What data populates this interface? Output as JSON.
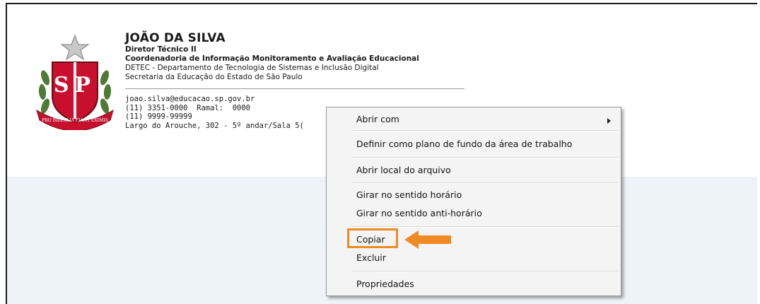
{
  "signature": {
    "name": "JOÃO DA SILVA",
    "role": "Diretor Técnico II",
    "department": "Coordenadoria de Informação Monitoramento e Avaliação Educacional",
    "division": "DETEC - Departamento de Tecnologia de Sistemas e Inclusão Digital",
    "secretariat": "Secretaria da Educação do Estado de São Paulo",
    "email": "joao.silva@educacao.sp.gov.br",
    "phone": "(11) 3351-0000  Ramal:  0000",
    "mobile": "(11) 9999-99999",
    "address": "Largo do Arouche, 302 - 5º andar/Sala 5("
  },
  "emblem": {
    "letters": "SP",
    "ribbon_text": "PRO BRASILIA FIANT EXIMIA"
  },
  "context_menu": {
    "items": [
      {
        "label": "Abrir com",
        "has_submenu": true
      },
      {
        "label": "Definir como plano de fundo da área de trabalho"
      },
      {
        "label": "Abrir local do arquivo"
      },
      {
        "label": "Girar no sentido horário"
      },
      {
        "label": "Girar no sentido anti-horário"
      },
      {
        "label": "Copiar",
        "highlighted": true
      },
      {
        "label": "Excluir"
      },
      {
        "label": "Propriedades"
      }
    ]
  },
  "colors": {
    "highlight": "#f08a24",
    "emblem_red": "#c8102e",
    "background_lower": "#eef3fa"
  }
}
